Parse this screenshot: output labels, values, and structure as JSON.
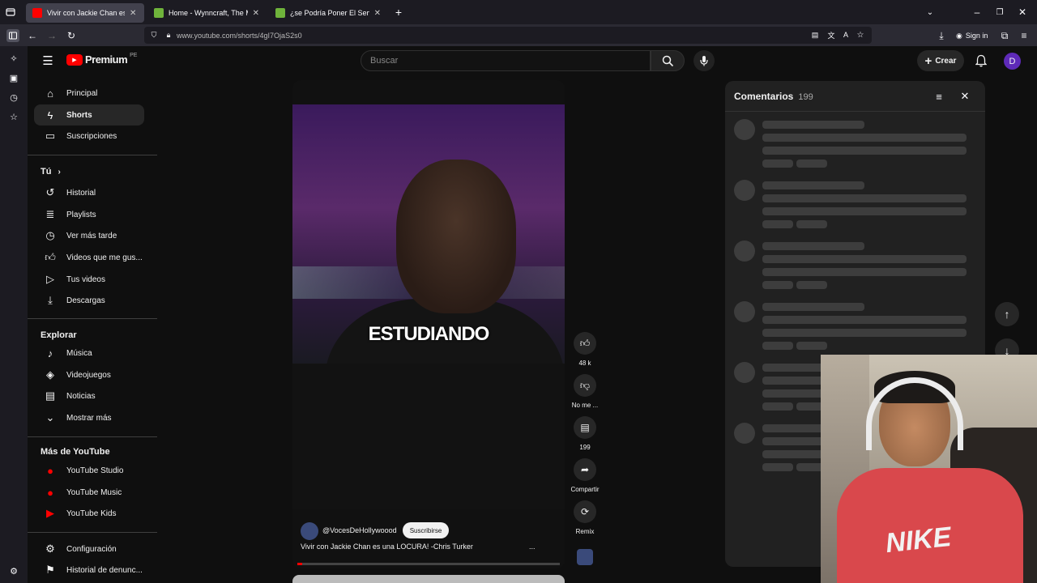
{
  "browser": {
    "tabs": [
      {
        "title": "Vivir con Jackie Chan es una LOCURA!",
        "active": true,
        "favicon": "youtube"
      },
      {
        "title": "Home - Wynncraft, The Minecraft MMO",
        "active": false,
        "favicon": "wynncraft"
      },
      {
        "title": "¿se Podría Poner El Servidor En",
        "active": false,
        "favicon": "wynncraft"
      }
    ],
    "new_tab": "+",
    "url": "www.youtube.com/shorts/4gI7OjaS2s0",
    "sign_in": "Sign in"
  },
  "header": {
    "logo": "Premium",
    "region": "PE",
    "search_placeholder": "Buscar",
    "create_label": "Crear",
    "avatar_letter": "D"
  },
  "sidebar": {
    "primary": [
      {
        "label": "Principal",
        "icon": "home-icon"
      },
      {
        "label": "Shorts",
        "icon": "shorts-icon",
        "active": true
      },
      {
        "label": "Suscripciones",
        "icon": "subscriptions-icon"
      }
    ],
    "you_title": "Tú",
    "you_items": [
      {
        "label": "Historial",
        "icon": "history-icon"
      },
      {
        "label": "Playlists",
        "icon": "playlist-icon"
      },
      {
        "label": "Ver más tarde",
        "icon": "clock-icon"
      },
      {
        "label": "Videos que me gus...",
        "icon": "like-icon"
      },
      {
        "label": "Tus videos",
        "icon": "video-icon"
      },
      {
        "label": "Descargas",
        "icon": "download-icon"
      }
    ],
    "explore_title": "Explorar",
    "explore_items": [
      {
        "label": "Música",
        "icon": "music-icon"
      },
      {
        "label": "Videojuegos",
        "icon": "gaming-icon"
      },
      {
        "label": "Noticias",
        "icon": "news-icon"
      },
      {
        "label": "Mostrar más",
        "icon": "chevron-down-icon"
      }
    ],
    "more_title": "Más de YouTube",
    "more_items": [
      {
        "label": "YouTube Studio",
        "icon": "yt-studio-icon"
      },
      {
        "label": "YouTube Music",
        "icon": "yt-music-icon"
      },
      {
        "label": "YouTube Kids",
        "icon": "yt-kids-icon"
      }
    ],
    "footer_items": [
      {
        "label": "Configuración",
        "icon": "gear-icon"
      },
      {
        "label": "Historial de denunc...",
        "icon": "flag-icon"
      }
    ]
  },
  "short": {
    "caption": "ESTUDIANDO",
    "channel": "@VocesDeHollywoood",
    "subscribe": "Suscribirse",
    "title": "Vivir con Jackie Chan es una LOCURA! -Chris Turker",
    "more": "...",
    "progress": 0.02
  },
  "actions": {
    "likes": "48 k",
    "dislike": "No me ...",
    "comments": "199",
    "share": "Compartir",
    "remix": "Remix"
  },
  "comments_panel": {
    "title": "Comentarios",
    "count": "199"
  },
  "colors": {
    "accent": "#ff0000",
    "background": "#0f0f0f",
    "panel": "#212121",
    "avatar": "#5e2ab8"
  }
}
